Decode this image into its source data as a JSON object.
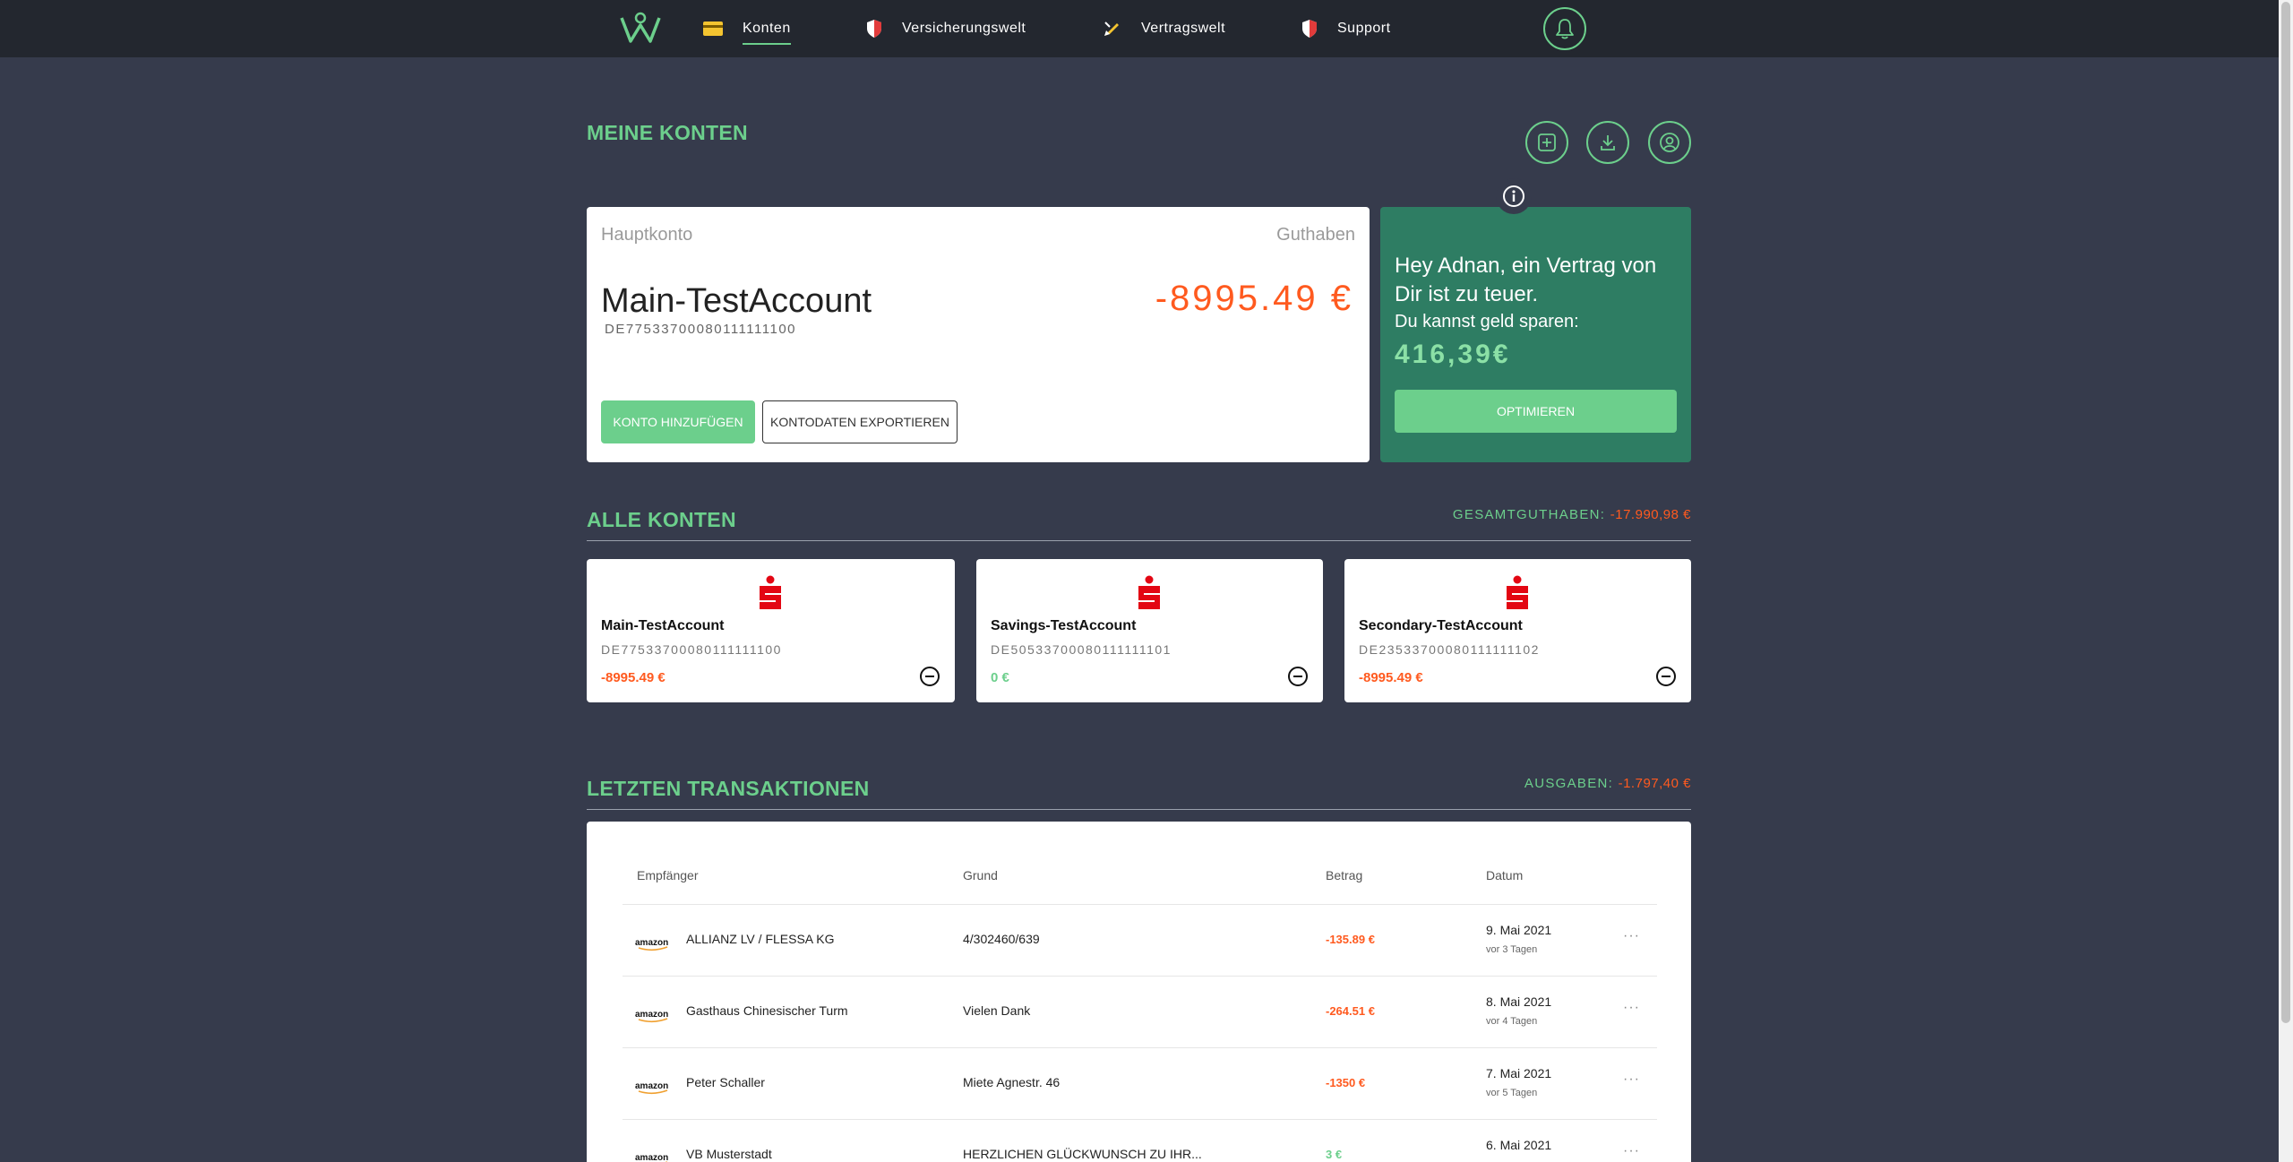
{
  "nav": {
    "items": [
      {
        "label": "Konten",
        "icon": "card-icon"
      },
      {
        "label": "Versicherungswelt",
        "icon": "shield-icon"
      },
      {
        "label": "Vertragswelt",
        "icon": "pen-icon"
      },
      {
        "label": "Support",
        "icon": "shield-icon"
      }
    ],
    "bell_icon": "bell-icon"
  },
  "colors": {
    "accent": "#6ccf8c",
    "negative": "#ff5a1f",
    "promo_bg": "#2e7d63",
    "bg": "#363b4c"
  },
  "my_accounts": {
    "title": "MEINE KONTEN",
    "actions": [
      "add-icon",
      "download-icon",
      "user-icon"
    ]
  },
  "main_account": {
    "label": "Hauptkonto",
    "balance_label": "Guthaben",
    "name": "Main-TestAccount",
    "iban": "DE77533700080111111100",
    "balance": "-8995.49 €",
    "add_button": "KONTO HINZUFÜGEN",
    "export_button": "KONTODATEN EXPORTIEREN"
  },
  "promo": {
    "headline": "Hey Adnan, ein Vertrag von Dir ist zu teuer.",
    "sub": "Du kannst geld sparen:",
    "amount": "416,39€",
    "button": "OPTIMIEREN"
  },
  "all_accounts": {
    "title": "ALLE KONTEN",
    "total_label": "GESAMTGUTHABEN:",
    "total_value": "-17.990,98 €",
    "accounts": [
      {
        "name": "Main-TestAccount",
        "iban": "DE77533700080111111100",
        "balance": "-8995.49 €"
      },
      {
        "name": "Savings-TestAccount",
        "iban": "DE50533700080111111101",
        "balance": "0 €"
      },
      {
        "name": "Secondary-TestAccount",
        "iban": "DE23533700080111111102",
        "balance": "-8995.49 €"
      }
    ]
  },
  "transactions": {
    "title": "LETZTEN TRANSAKTIONEN",
    "total_label": "AUSGABEN:",
    "total_value": "-1.797,40 €",
    "headers": [
      "Empfänger",
      "Grund",
      "Betrag",
      "Datum"
    ],
    "rows": [
      {
        "logo": "amazon",
        "recipient": "ALLIANZ LV / FLESSA KG",
        "reason": "4/302460/639",
        "amount": "-135.89 €",
        "date": "9. Mai 2021",
        "ago": "vor 3 Tagen"
      },
      {
        "logo": "amazon",
        "recipient": "Gasthaus Chinesischer Turm",
        "reason": "Vielen Dank",
        "amount": "-264.51 €",
        "date": "8. Mai 2021",
        "ago": "vor 4 Tagen"
      },
      {
        "logo": "amazon",
        "recipient": "Peter Schaller",
        "reason": "Miete Agnestr. 46",
        "amount": "-1350 €",
        "date": "7. Mai 2021",
        "ago": "vor 5 Tagen"
      },
      {
        "logo": "amazon",
        "recipient": "VB Musterstadt",
        "reason": "HERZLICHEN GLÜCKWUNSCH ZU IHR...",
        "amount": "3 €",
        "date": "6. Mai 2021",
        "ago": ""
      }
    ],
    "more": "···"
  }
}
